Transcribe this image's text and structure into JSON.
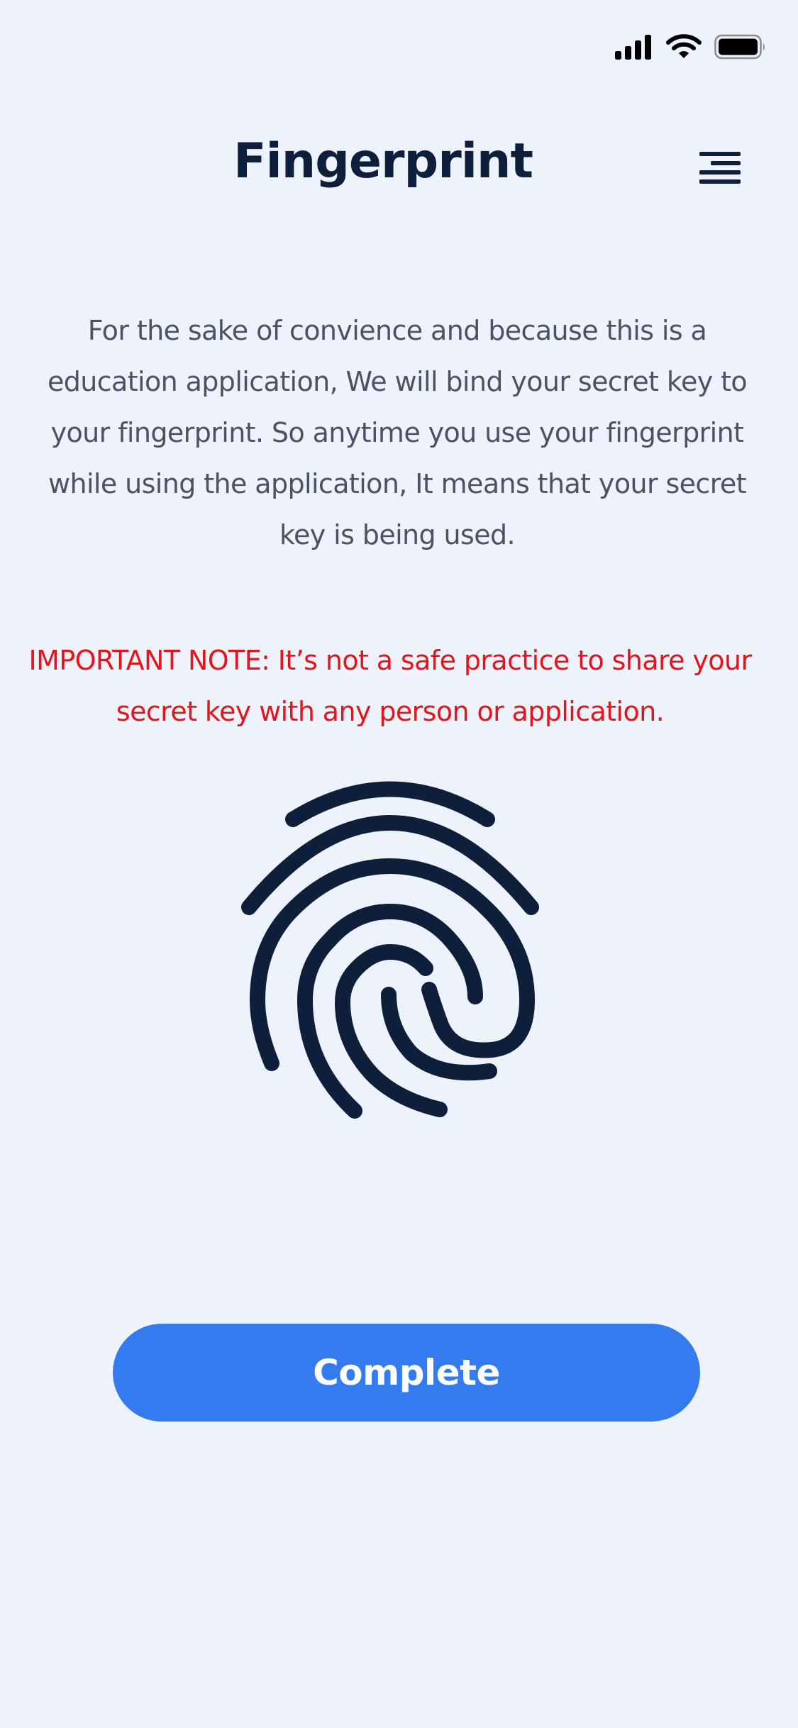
{
  "status_bar": {
    "signal_icon": "cellular-signal-icon",
    "wifi_icon": "wifi-icon",
    "battery_icon": "battery-icon"
  },
  "header": {
    "title": "Fingerprint",
    "menu_icon": "menu-lines-icon"
  },
  "description": "For the sake of convience and because this is a education application, We will bind your secret key to your fingerprint. So anytime you use your fingerprint while using the application, It means that your secret key is being used.",
  "important_note": "IMPORTANT NOTE: It’s not a safe practice to share your secret key with any person or application.",
  "fingerprint_icon": "fingerprint-icon",
  "complete_button": {
    "label": "Complete"
  },
  "colors": {
    "background": "#EEF2FA",
    "title": "#0E1F3C",
    "body_text": "#4B5266",
    "warning": "#E3141B",
    "accent": "#347BEF"
  }
}
